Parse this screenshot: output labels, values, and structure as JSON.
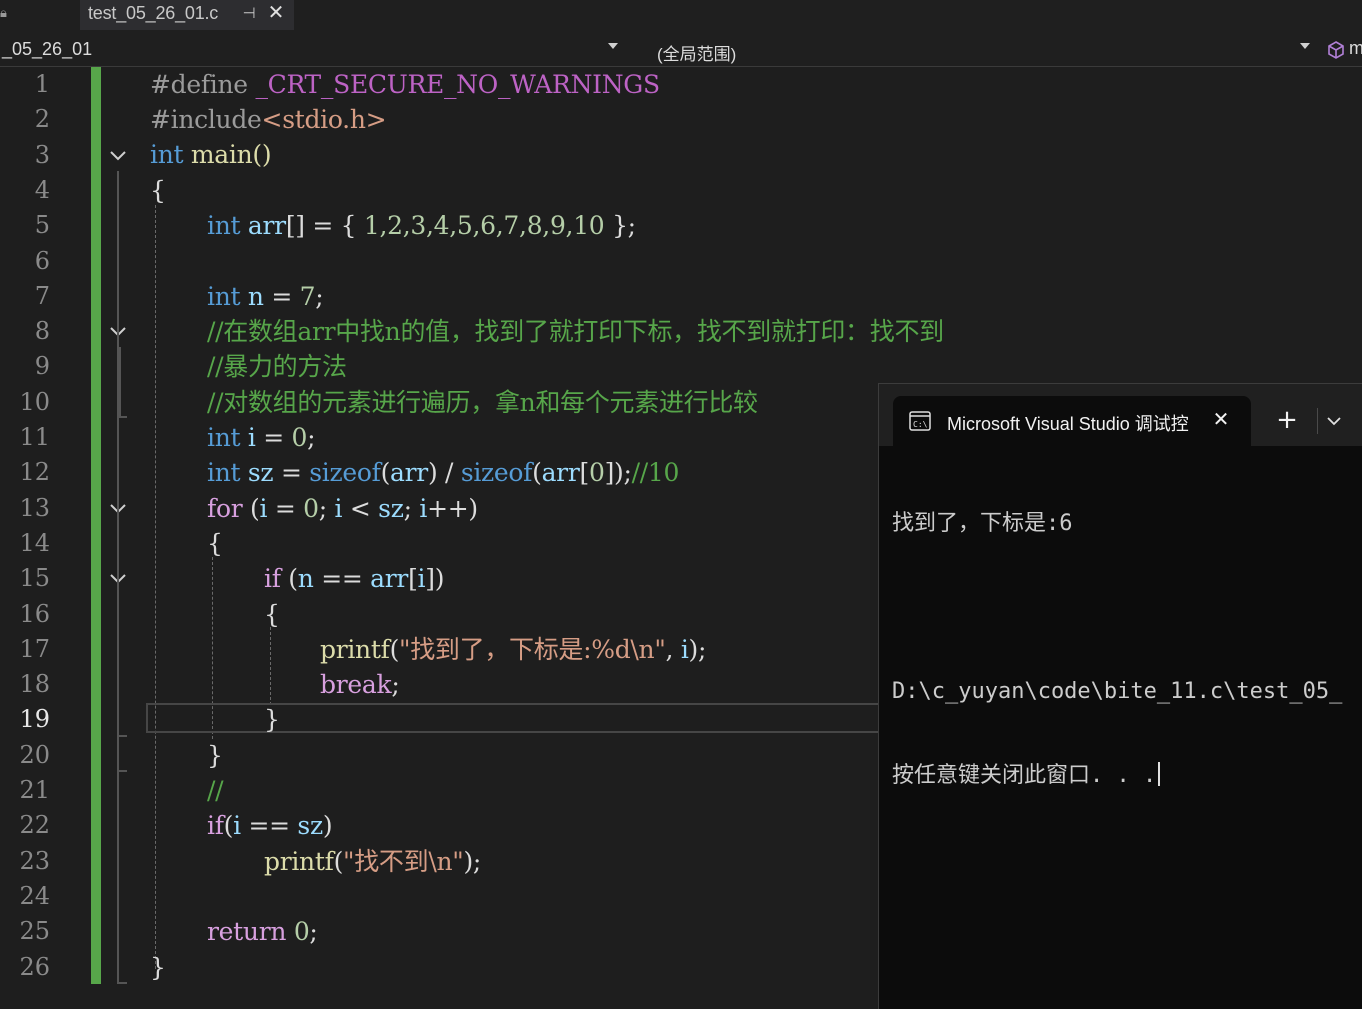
{
  "tab": {
    "title": "test_05_26_01.c",
    "pin_glyph": "⊣",
    "close_glyph": "✕"
  },
  "nav": {
    "project": "_05_26_01",
    "scope": "(全局范围)",
    "member": "m"
  },
  "editor": {
    "current_line": 19,
    "line_numbers": [
      "1",
      "2",
      "3",
      "4",
      "5",
      "6",
      "7",
      "8",
      "9",
      "10",
      "11",
      "12",
      "13",
      "14",
      "15",
      "16",
      "17",
      "18",
      "19",
      "20",
      "21",
      "22",
      "23",
      "24",
      "25",
      "26"
    ],
    "code": {
      "l1_a": "#define",
      "l1_b": " _CRT_SECURE_NO_WARNINGS",
      "l2_a": "#include",
      "l2_b": "<stdio.h>",
      "l3_a": "int",
      "l3_b": " main()",
      "l4": "{",
      "l5_a": "int",
      "l5_b": " arr",
      "l5_c": "[] = { ",
      "l5_d": "1,2,3,4,5,6,7,8,9,10",
      "l5_e": " };",
      "l7_a": "int",
      "l7_b": " n",
      "l7_c": " = ",
      "l7_d": "7",
      "l7_e": ";",
      "l8": "//在数组arr中找n的值，找到了就打印下标，找不到就打印：找不到",
      "l9": "//暴力的方法",
      "l10": "//对数组的元素进行遍历，拿n和每个元素进行比较",
      "l11_a": "int",
      "l11_b": " i",
      "l11_c": " = ",
      "l11_d": "0",
      "l11_e": ";",
      "l12_a": "int",
      "l12_b": " sz",
      "l12_c": " = ",
      "l12_d": "sizeof",
      "l12_e": "(",
      "l12_f": "arr",
      "l12_g": ") / ",
      "l12_h": "sizeof",
      "l12_i": "(",
      "l12_j": "arr",
      "l12_k": "[",
      "l12_l": "0",
      "l12_m": "]);",
      "l12_n": "//10",
      "l13_a": "for",
      "l13_b": " (",
      "l13_c": "i",
      "l13_d": " = ",
      "l13_e": "0",
      "l13_f": "; ",
      "l13_g": "i",
      "l13_h": " < ",
      "l13_i": "sz",
      "l13_j": "; ",
      "l13_k": "i",
      "l13_l": "++)",
      "l14": "{",
      "l15_a": "if",
      "l15_b": " (",
      "l15_c": "n",
      "l15_d": " == ",
      "l15_e": "arr",
      "l15_f": "[",
      "l15_g": "i",
      "l15_h": "])",
      "l16": "{",
      "l17_a": "printf",
      "l17_b": "(",
      "l17_c": "\"找到了，下标是:%d\\n\"",
      "l17_d": ", ",
      "l17_e": "i",
      "l17_f": ");",
      "l18_a": "break",
      "l18_b": ";",
      "l19": "}",
      "l20": "}",
      "l21": "//",
      "l22_a": "if",
      "l22_b": "(",
      "l22_c": "i",
      "l22_d": " == ",
      "l22_e": "sz",
      "l22_f": ")",
      "l23_a": "printf",
      "l23_b": "(",
      "l23_c": "\"找不到\\n\"",
      "l23_d": ");",
      "l25_a": "return",
      "l25_b": " ",
      "l25_c": "0",
      "l25_d": ";",
      "l26": "}"
    }
  },
  "console": {
    "title": "Microsoft Visual Studio 调试控",
    "close_glyph": "✕",
    "new_tab_glyph": "+",
    "lines": [
      "找到了，下标是:6",
      "",
      "D:\\c_yuyan\\code\\bite_11.c\\test_05_",
      "按任意键关闭此窗口. . ."
    ]
  },
  "colors": {
    "keyword": "#569cd6",
    "control_keyword": "#d8a0df",
    "comment": "#57a64a",
    "string": "#d69d85",
    "number": "#b5cea8",
    "variable": "#9cdcfe",
    "function": "#dcdcaa",
    "macro": "#bd63c5",
    "change_bar": "#57a64a",
    "editor_bg": "#1e1e1e",
    "console_bg": "#0c0c0c"
  }
}
